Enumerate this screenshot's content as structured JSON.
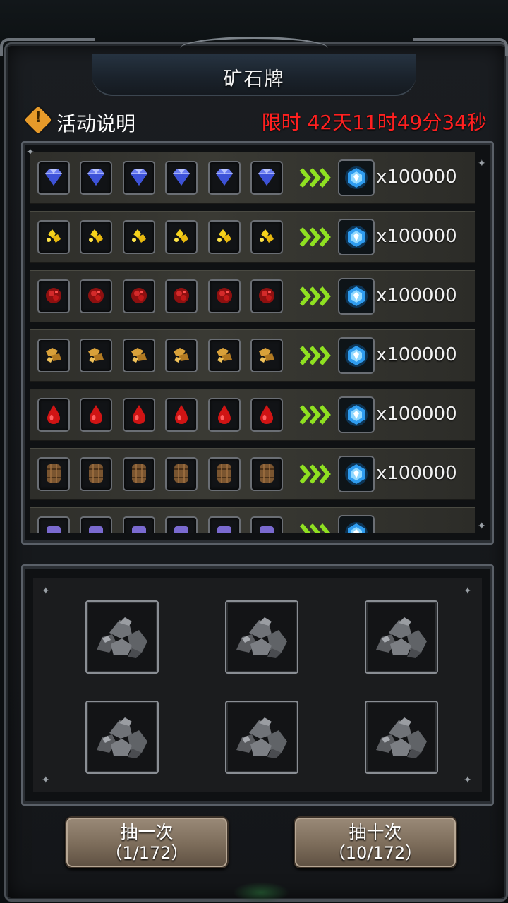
{
  "header": {
    "title": "矿石牌",
    "info_label": "活动说明",
    "info_icon": "warning-icon",
    "timer": "限时 42天11时49分34秒"
  },
  "colors": {
    "timer": "#ff2020",
    "arrow": "#8fe021",
    "crystal": "#3fb6ff",
    "button": "#8c7c6a"
  },
  "rewards": {
    "arrow_icon": "green-arrows-icon",
    "reward_icon": "blue-crystal-icon",
    "rows": [
      {
        "ore": "diamond",
        "icon": "diamond-icon",
        "amount": "x100000"
      },
      {
        "ore": "gold",
        "icon": "gold-nugget-icon",
        "amount": "x100000"
      },
      {
        "ore": "ruby",
        "icon": "red-ore-icon",
        "amount": "x100000"
      },
      {
        "ore": "bronze",
        "icon": "bronze-ore-icon",
        "amount": "x100000"
      },
      {
        "ore": "blood",
        "icon": "blood-drop-icon",
        "amount": "x100000"
      },
      {
        "ore": "wood",
        "icon": "wood-barrel-icon",
        "amount": "x100000"
      }
    ]
  },
  "board": {
    "card_icon": "ore-rock-icon",
    "cards": 6
  },
  "buttons": {
    "draw_one": {
      "label": "抽一次",
      "count": "（1/172）"
    },
    "draw_ten": {
      "label": "抽十次",
      "count": "（10/172）"
    }
  }
}
